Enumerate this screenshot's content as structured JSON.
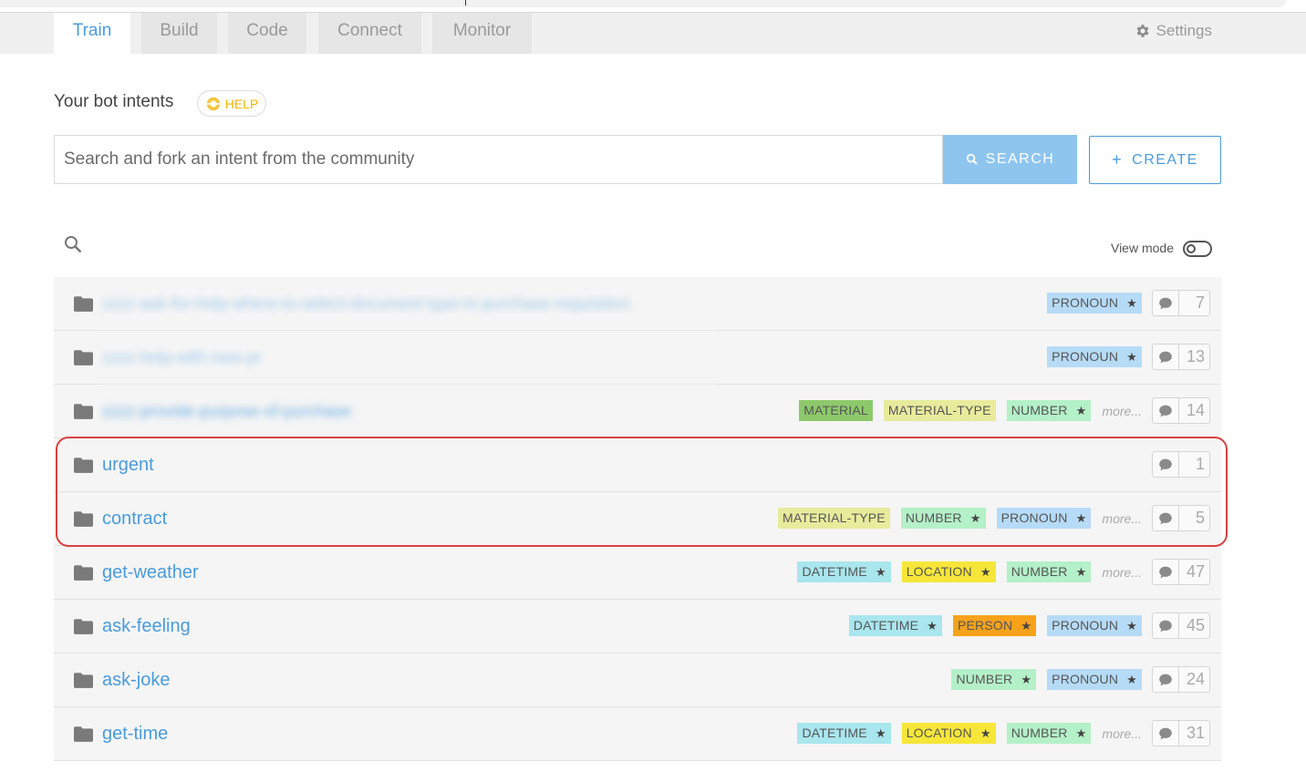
{
  "nav": {
    "tabs": [
      {
        "label": "Train",
        "active": true
      },
      {
        "label": "Build",
        "active": false
      },
      {
        "label": "Code",
        "active": false
      },
      {
        "label": "Connect",
        "active": false
      },
      {
        "label": "Monitor",
        "active": false
      }
    ],
    "settings_label": "Settings"
  },
  "header": {
    "title": "Your bot intents",
    "help_label": "HELP"
  },
  "search": {
    "placeholder": "Search and fork an intent from the community",
    "search_button": "SEARCH",
    "create_button": "CREATE"
  },
  "list_controls": {
    "view_mode_label": "View mode"
  },
  "colors": {
    "accent": "#4a9bdc",
    "search_button": "#8ec5ef",
    "highlight": "#d94040",
    "tag_PRONOUN": "#b6dbf7",
    "tag_NUMBER": "#b4f0c8",
    "tag_MATERIAL": "#8dc96b",
    "tag_MATERIAL-TYPE": "#e8eb9c",
    "tag_DATETIME": "#a9e6ee",
    "tag_LOCATION": "#f6e63a",
    "tag_PERSON": "#f7a21b"
  },
  "intents": [
    {
      "name": "zzzz-ask-for-help-where-to-select-document-type-in-purchase-requisition",
      "blurred": true,
      "tags": [
        "PRONOUN"
      ],
      "more": false,
      "count": "7"
    },
    {
      "name": "zzzz-help-with-new-pr",
      "blurred": true,
      "tags": [
        "PRONOUN"
      ],
      "more": false,
      "count": "13"
    },
    {
      "name": "zzzz-provide-purpose-of-purchase",
      "blurred": true,
      "tags": [
        "MATERIAL",
        "MATERIAL-TYPE",
        "NUMBER"
      ],
      "more": true,
      "count": "14"
    },
    {
      "name": "urgent",
      "blurred": false,
      "tags": [],
      "more": false,
      "count": "1"
    },
    {
      "name": "contract",
      "blurred": false,
      "tags": [
        "MATERIAL-TYPE",
        "NUMBER",
        "PRONOUN"
      ],
      "more": true,
      "count": "5"
    },
    {
      "name": "get-weather",
      "blurred": false,
      "tags": [
        "DATETIME",
        "LOCATION",
        "NUMBER"
      ],
      "more": true,
      "count": "47"
    },
    {
      "name": "ask-feeling",
      "blurred": false,
      "tags": [
        "DATETIME",
        "PERSON",
        "PRONOUN"
      ],
      "more": false,
      "count": "45"
    },
    {
      "name": "ask-joke",
      "blurred": false,
      "tags": [
        "NUMBER",
        "PRONOUN"
      ],
      "more": false,
      "count": "24"
    },
    {
      "name": "get-time",
      "blurred": false,
      "tags": [
        "DATETIME",
        "LOCATION",
        "NUMBER"
      ],
      "more": true,
      "count": "31"
    }
  ],
  "tag_star": {
    "PRONOUN": true,
    "NUMBER": true,
    "DATETIME": true,
    "LOCATION": true,
    "PERSON": true,
    "MATERIAL": false,
    "MATERIAL-TYPE": false
  },
  "more_label": "more..."
}
